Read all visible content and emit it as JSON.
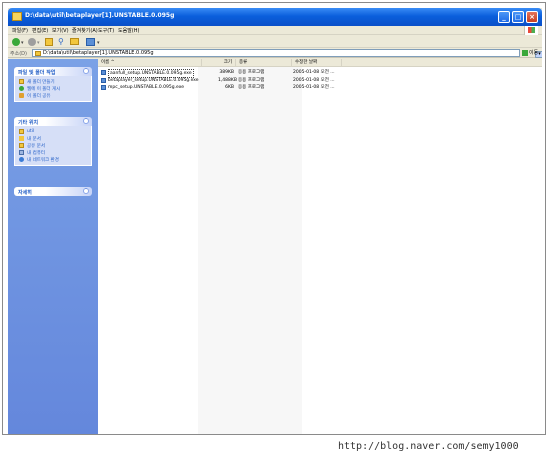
{
  "window": {
    "title": "D:\\data\\util\\betaplayer[1].UNSTABLE.0.095g"
  },
  "menu": [
    "파일(F)",
    "편집(E)",
    "보기(V)",
    "즐겨찾기(A)",
    "도구(T)",
    "도움말(H)"
  ],
  "toolbar": {
    "back_label": "",
    "forward_label": ""
  },
  "address": {
    "label": "주소(D)",
    "value": "D:\\data\\util\\betaplayer[1].UNSTABLE.0.095g",
    "go_label": "이동"
  },
  "taskpane": {
    "file_tasks": {
      "title": "파일 및 폴더 작업",
      "items": [
        "새 폴더 만들기",
        "웹에 이 폴더 게시",
        "이 폴더 공유"
      ]
    },
    "other_places": {
      "title": "기타 위치",
      "items": [
        "util",
        "내 문서",
        "공유 문서",
        "내 컴퓨터",
        "내 네트워크 환경"
      ]
    },
    "details": {
      "title": "자세히"
    }
  },
  "columns": {
    "name": "이름",
    "size": "크기",
    "type": "종류",
    "date": "수정한 날짜"
  },
  "files": [
    {
      "name": "aanfull_setup.UNSTABLE.0.095g.exe",
      "size": "389KB",
      "type": "응용 프로그램",
      "date": "2005-01-08 오전 ..."
    },
    {
      "name": "betaplayer_setup.UNSTABLE.0.095g.exe",
      "size": "1,488KB",
      "type": "응용 프로그램",
      "date": "2005-01-08 오전 ..."
    },
    {
      "name": "mpc_setup.UNSTABLE.0.095g.exe",
      "size": "6KB",
      "type": "응용 프로그램",
      "date": "2005-01-08 오전 ..."
    }
  ],
  "watermark": "http://blog.naver.com/semy1000"
}
